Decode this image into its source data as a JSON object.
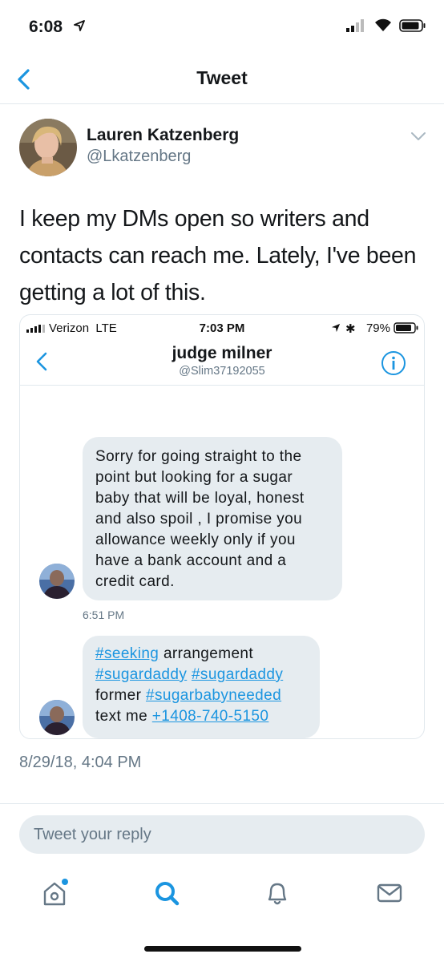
{
  "status_bar": {
    "time": "6:08"
  },
  "nav": {
    "title": "Tweet"
  },
  "tweet": {
    "author_name": "Lauren Katzenberg",
    "author_handle": "@Lkatzenberg",
    "text": "I keep my DMs open so writers and contacts can reach me. Lately, I've been getting a lot of this.",
    "timestamp": "8/29/18, 4:04 PM"
  },
  "embedded_screenshot": {
    "carrier": "Verizon",
    "network": "LTE",
    "time": "7:03 PM",
    "battery": "79%",
    "contact_name": "judge milner",
    "contact_handle": "@Slim37192055",
    "message1": "Sorry for going straight to the point but looking for a sugar baby that will be loyal, honest and also spoil , I promise you allowance weekly only if you have a bank account and a credit card.",
    "message1_time": "6:51 PM",
    "message2": {
      "link1": "#seeking",
      "text1": " arrangement",
      "link2": "#sugardaddy",
      "link3": "#sugardaddy",
      "text2": "former ",
      "link4": "#sugarbabyneeded",
      "text3": "text me ",
      "link5": "+1408-740-5150"
    }
  },
  "reply": {
    "placeholder": "Tweet your reply"
  },
  "tabs": [
    {
      "icon": "home-icon"
    },
    {
      "icon": "search-icon"
    },
    {
      "icon": "notifications-icon"
    },
    {
      "icon": "messages-icon"
    }
  ],
  "colors": {
    "accent": "#1b95e0",
    "bubble": "#e6ecf0",
    "secondary_text": "#657786"
  }
}
